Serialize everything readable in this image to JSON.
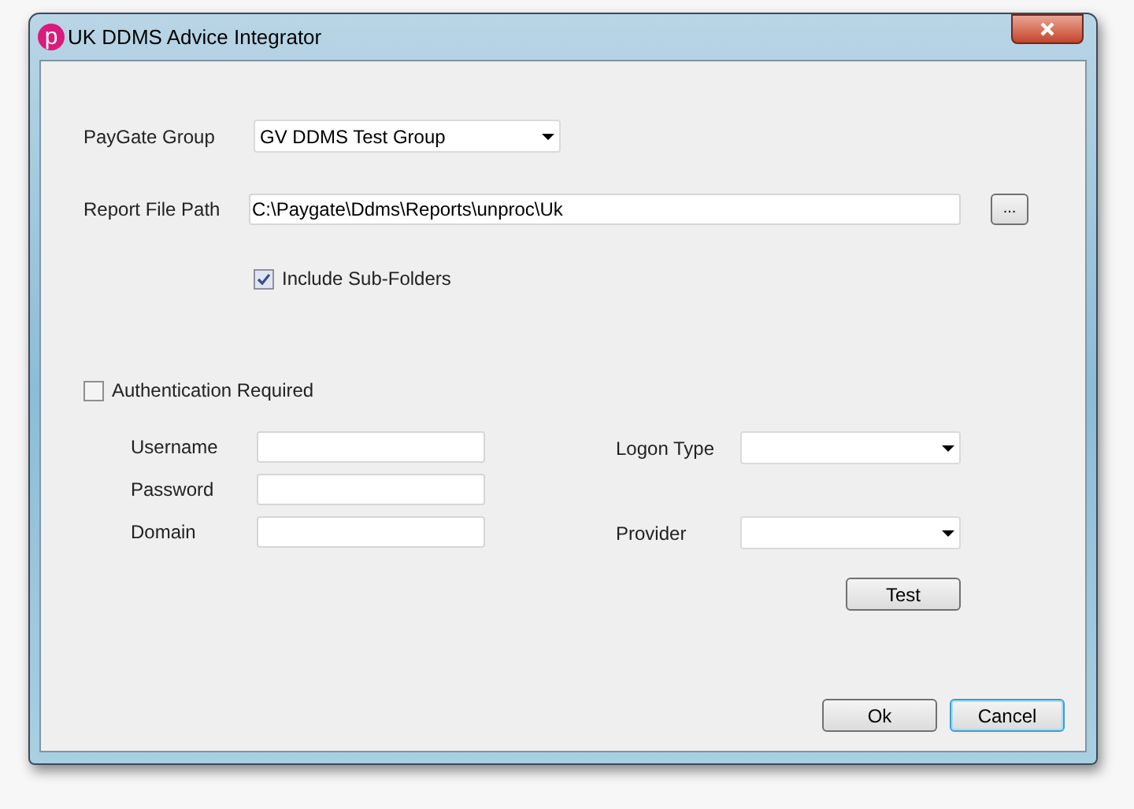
{
  "window": {
    "title": "UK DDMS Advice Integrator",
    "logo_letter": "p"
  },
  "paygate_group": {
    "label": "PayGate Group",
    "value": "GV DDMS Test Group"
  },
  "report_file_path": {
    "label": "Report File Path",
    "value": "C:\\Paygate\\Ddms\\Reports\\unproc\\Uk",
    "browse_label": "..."
  },
  "include_sub_folders": {
    "label": "Include Sub-Folders",
    "checked": true
  },
  "authentication": {
    "label": "Authentication Required",
    "checked": false,
    "username": {
      "label": "Username"
    },
    "password": {
      "label": "Password"
    },
    "domain": {
      "label": "Domain"
    },
    "logon_type": {
      "label": "Logon Type"
    },
    "provider": {
      "label": "Provider"
    },
    "test_button": "Test"
  },
  "buttons": [
    {
      "label": "Ok",
      "focused": false
    },
    {
      "label": "Cancel",
      "focused": true
    }
  ]
}
